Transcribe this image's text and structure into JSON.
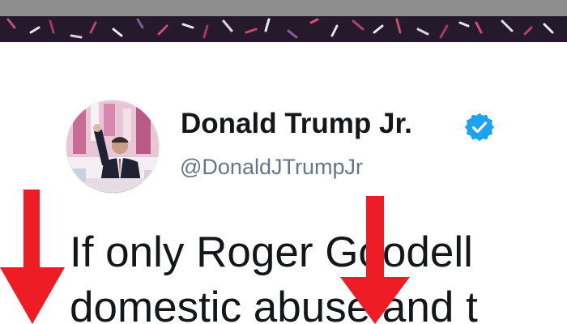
{
  "profile": {
    "display_name": "Donald Trump Jr.",
    "handle": "@DonaldJTrumpJr",
    "verified": true
  },
  "tweet": {
    "lines": [
      "If only Roger Goodell",
      "domestic abuse and t"
    ]
  },
  "colors": {
    "text_primary": "#14171a",
    "text_secondary": "#657786",
    "verified_blue": "#1da1f2",
    "arrow_red": "#ee1c25",
    "banner_dark": "#241a2c",
    "top_strip_grey": "#8e8e8e"
  },
  "icons": {
    "verified": "verified-badge-icon",
    "annotation_arrows": "down-arrow-icon"
  }
}
